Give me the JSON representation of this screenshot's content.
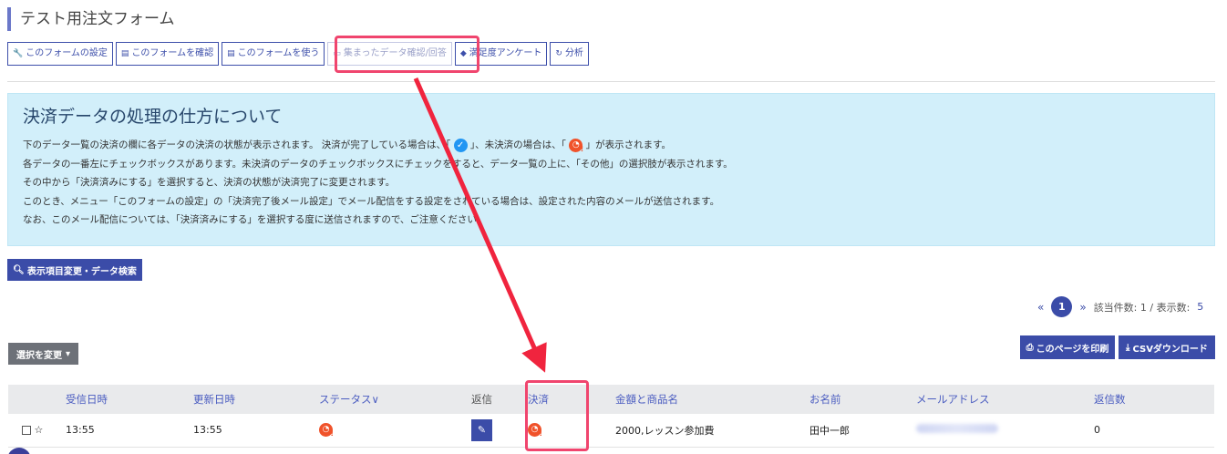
{
  "page": {
    "title": "テスト用注文フォーム"
  },
  "tabs": [
    {
      "label": "このフォームの設定",
      "icon": "wrench-icon",
      "glyph": "🔧"
    },
    {
      "label": "このフォームを確認",
      "icon": "document-icon",
      "glyph": "▤"
    },
    {
      "label": "このフォームを使う",
      "icon": "document-icon",
      "glyph": "▤"
    },
    {
      "label": "集まったデータ確認/回答",
      "icon": "comment-icon",
      "glyph": "▭"
    },
    {
      "label": "満足度アンケート",
      "icon": "layers-icon",
      "glyph": "◆"
    },
    {
      "label": "分析",
      "icon": "refresh-icon",
      "glyph": "↻"
    }
  ],
  "info": {
    "heading": "決済データの処理の仕方について",
    "line1_a": "下のデータ一覧の決済の欄に各データの決済の状態が表示されます。 決済が完了している場合は、「",
    "line1_b": "」、未決済の場合は、「",
    "line1_c": "」が表示されます。",
    "line2": "各データの一番左にチェックボックスがあります。未決済のデータのチェックボックスにチェックをすると、データ一覧の上に、「その他」の選択肢が表示されます。",
    "line3": "その中から「決済済みにする」を選択すると、決済の状態が決済完了に変更されます。",
    "line4": "このとき、メニュー「このフォームの設定」の「決済完了後メール設定」でメール配信をする設定をされている場合は、設定された内容のメールが送信されます。",
    "line5": "なお、このメール配信については、「決済済みにする」を選択する度に送信されますので、ご注意ください。"
  },
  "search_button": {
    "label": "表示項目変更・データ検索"
  },
  "pager": {
    "prev": "«",
    "page": "1",
    "next": "»",
    "summary": "該当件数: 1 / 表示数:",
    "per_page": "5"
  },
  "select_button": {
    "label": "選択を変更"
  },
  "print_button": {
    "label": "このページを印刷"
  },
  "csv_button": {
    "label": "CSVダウンロード"
  },
  "table": {
    "headers": [
      "受信日時",
      "更新日時",
      "ステータス∨",
      "返信",
      "決済",
      "金額と商品名",
      "お名前",
      "メールアドレス",
      "返信数"
    ],
    "rows": [
      {
        "received": "13:55",
        "updated": "13:55",
        "amount_item": "2000,レッスン参加費",
        "name": "田中一郎",
        "replies": "0"
      }
    ]
  },
  "colors": {
    "accent": "#3b4ca8",
    "info_bg": "#d2effa",
    "highlight": "#f0456e",
    "unpaid": "#f0522a",
    "paid": "#2196f3"
  }
}
